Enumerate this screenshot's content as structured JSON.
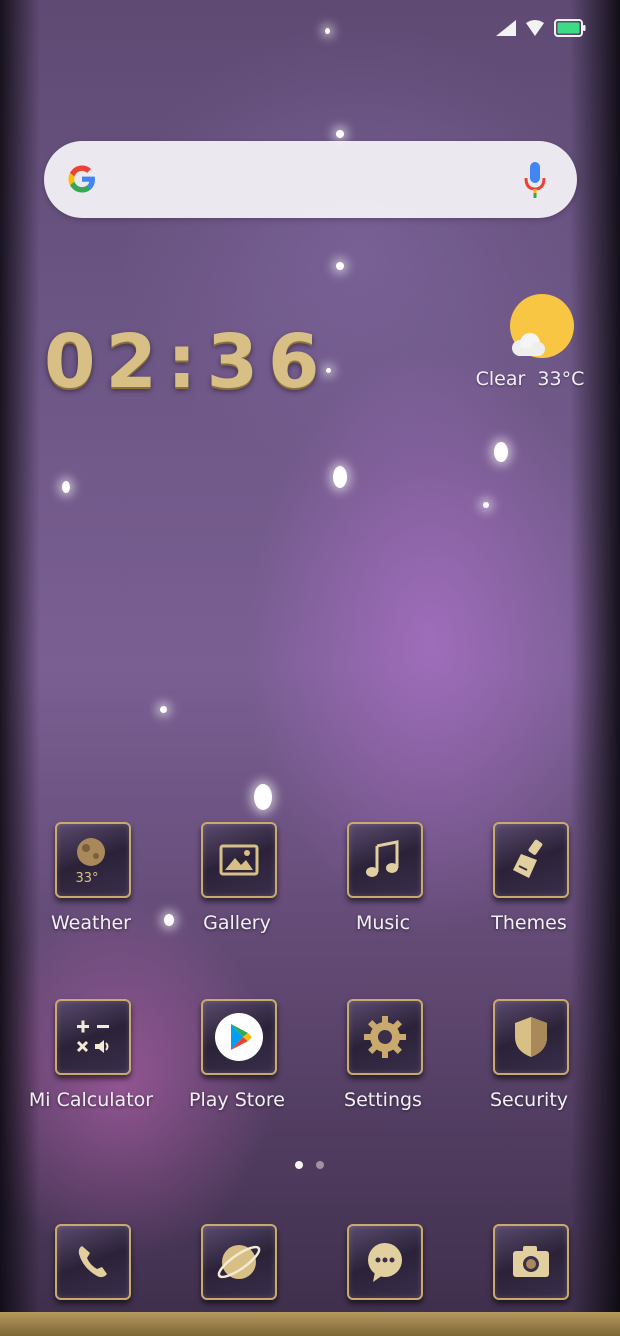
{
  "status_bar": {
    "icons": [
      "signal-icon",
      "wifi-icon",
      "battery-icon"
    ],
    "battery_color": "#3ddc84"
  },
  "search": {
    "logo": "google-logo",
    "mic": "microphone-icon"
  },
  "clock": {
    "time": "02:36"
  },
  "weather_widget": {
    "condition": "Clear",
    "temperature": "33°C",
    "icon": "sun-with-cloud-icon"
  },
  "apps": [
    {
      "label": "Weather",
      "icon": "weather-icon",
      "icon_text": "33°"
    },
    {
      "label": "Gallery",
      "icon": "gallery-icon"
    },
    {
      "label": "Music",
      "icon": "music-icon"
    },
    {
      "label": "Themes",
      "icon": "brush-icon"
    },
    {
      "label": "Mi Calculator",
      "icon": "calculator-icon"
    },
    {
      "label": "Play Store",
      "icon": "play-store-icon"
    },
    {
      "label": "Settings",
      "icon": "gear-icon"
    },
    {
      "label": "Security",
      "icon": "shield-icon"
    }
  ],
  "page_indicator": {
    "pages": 2,
    "current": 1
  },
  "dock": [
    {
      "icon": "phone-icon"
    },
    {
      "icon": "browser-icon"
    },
    {
      "icon": "messages-icon"
    },
    {
      "icon": "camera-icon"
    }
  ],
  "colors": {
    "gold": "#c9aa6c",
    "clock_gold": "#d8bf86",
    "sun": "#f8c642"
  }
}
